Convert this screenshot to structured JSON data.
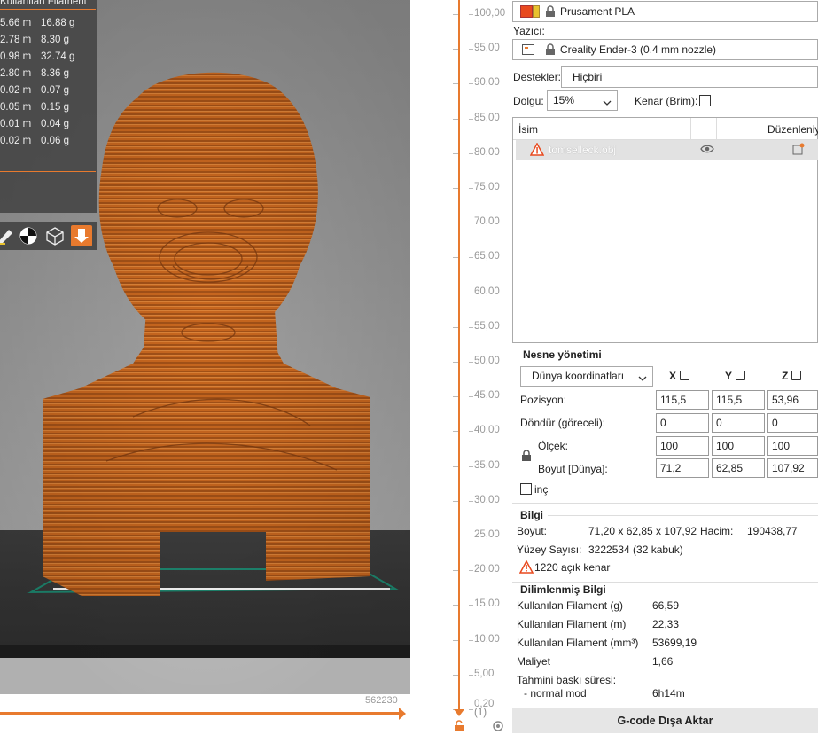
{
  "legend": {
    "header": "Kullanılan Filament",
    "rows": [
      {
        "m": "5.66 m",
        "g": "16.88 g"
      },
      {
        "m": "2.78 m",
        "g": "8.30 g"
      },
      {
        "m": "0.98 m",
        "g": "32.74 g"
      },
      {
        "m": "2.80 m",
        "g": "8.36 g"
      },
      {
        "m": "0.02 m",
        "g": "0.07 g"
      },
      {
        "m": "0.05 m",
        "g": "0.15 g"
      },
      {
        "m": "0.01 m",
        "g": "0.04 g"
      },
      {
        "m": "0.02 m",
        "g": "0.06 g"
      }
    ]
  },
  "viewport": {
    "slider_value": "562230",
    "model_color": "#c8671f"
  },
  "layer_slider": {
    "labels": [
      "100,00",
      "95,00",
      "90,00",
      "85,00",
      "80,00",
      "75,00",
      "70,00",
      "65,00",
      "60,00",
      "55,00",
      "50,00",
      "45,00",
      "40,00",
      "35,00",
      "30,00",
      "25,00",
      "20,00",
      "15,00",
      "10,00",
      "5,00",
      "0,20"
    ],
    "bottom_count": "(1)"
  },
  "panel": {
    "filament": "Prusament PLA",
    "printer_label": "Yazıcı:",
    "printer": "Creality Ender-3 (0.4 mm nozzle)",
    "supports_label": "Destekler:",
    "supports": "Hiçbiri",
    "infill_label": "Dolgu:",
    "infill": "15%",
    "brim_label": "Kenar (Brim):",
    "list_col_name": "İsim",
    "list_col_edit": "Düzenleniy",
    "object_name": "tomselleck.obj",
    "manip": {
      "title": "Nesne yönetimi",
      "coord_system": "Dünya koordinatları",
      "x": "X",
      "y": "Y",
      "z": "Z",
      "position_label": "Pozisyon:",
      "position": [
        "115,5",
        "115,5",
        "53,96"
      ],
      "rotate_label": "Döndür (göreceli):",
      "rotate": [
        "0",
        "0",
        "0"
      ],
      "scale_label": "Ölçek:",
      "scale": [
        "100",
        "100",
        "100"
      ],
      "size_label": "Boyut [Dünya]:",
      "size": [
        "71,2",
        "62,85",
        "107,92"
      ],
      "inch_label": "inç"
    },
    "info": {
      "title": "Bilgi",
      "size_label": "Boyut:",
      "size": "71,20 x 62,85 x 107,92",
      "volume_label": "Hacim:",
      "volume": "190438,77",
      "facets_label": "Yüzey Sayısı:",
      "facets": "3222534 (32 kabuk)",
      "warning": "1220 açık kenar"
    },
    "sliced": {
      "title": "Dilimlenmiş Bilgi",
      "rows": [
        {
          "label": "Kullanılan Filament (g)",
          "value": "66,59"
        },
        {
          "label": "Kullanılan Filament (m)",
          "value": "22,33"
        },
        {
          "label": "Kullanılan Filament (mm³)",
          "value": "53699,19"
        },
        {
          "label": "Maliyet",
          "value": "1,66"
        }
      ],
      "time_label": "Tahmini baskı süresi:",
      "mode_label": "- normal mod",
      "mode_value": "6h14m"
    },
    "export_button": "G-code Dışa Aktar"
  }
}
